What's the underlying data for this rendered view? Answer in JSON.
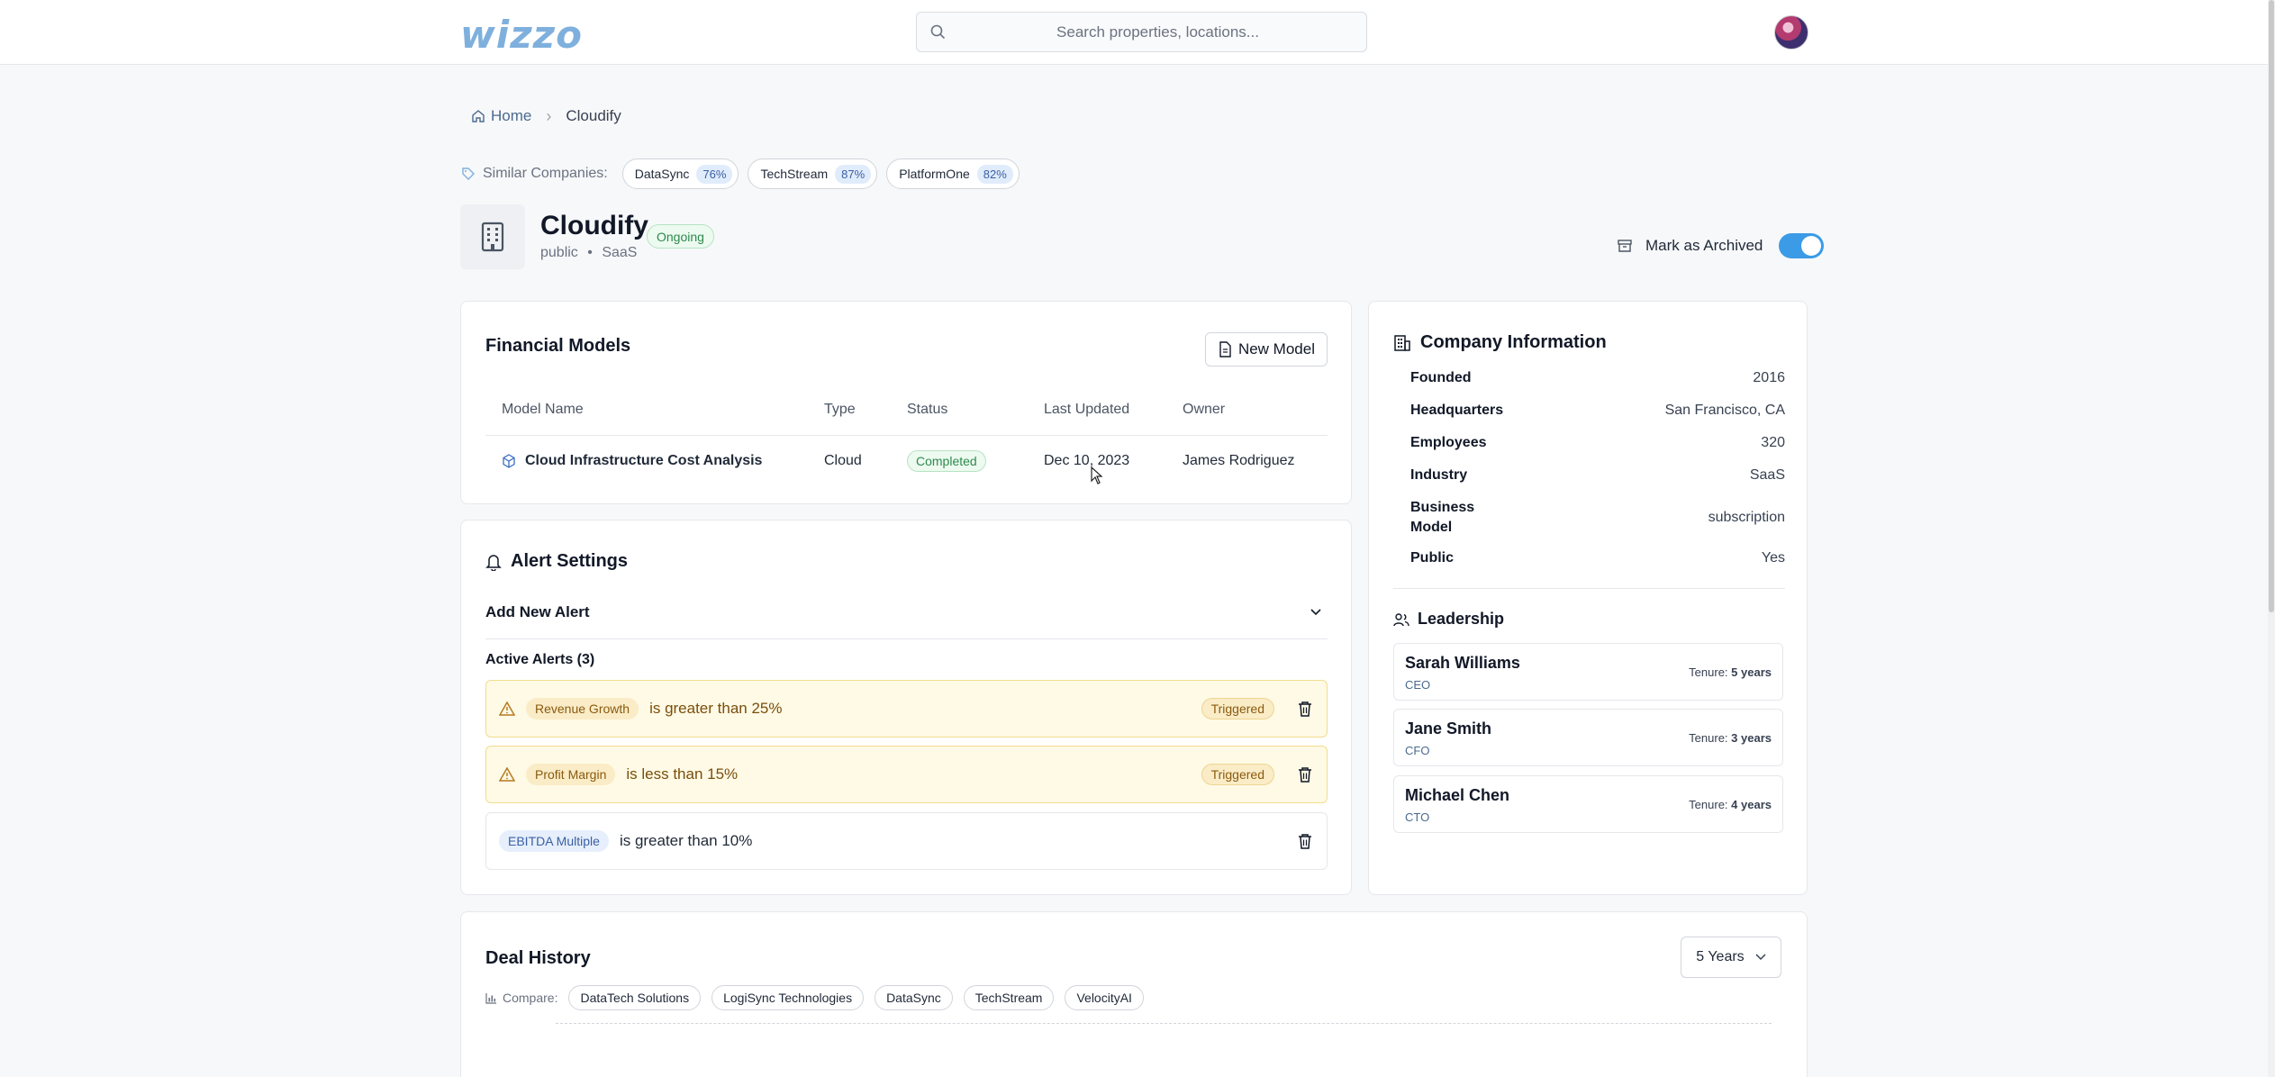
{
  "app": {
    "logo": "wizzo"
  },
  "search": {
    "placeholder": "Search properties, locations..."
  },
  "breadcrumb": {
    "home": "Home",
    "current": "Cloudify"
  },
  "similar": {
    "label": "Similar Companies:",
    "items": [
      {
        "name": "DataSync",
        "pct": "76%"
      },
      {
        "name": "TechStream",
        "pct": "87%"
      },
      {
        "name": "PlatformOne",
        "pct": "82%"
      }
    ]
  },
  "company": {
    "name": "Cloudify",
    "status": "Ongoing",
    "type": "public",
    "sector": "SaaS",
    "separator": "•"
  },
  "archive": {
    "label": "Mark as Archived",
    "enabled": true
  },
  "financial_models": {
    "title": "Financial Models",
    "new_button": "New Model",
    "columns": [
      "Model Name",
      "Type",
      "Status",
      "Last Updated",
      "Owner"
    ],
    "rows": [
      {
        "name": "Cloud Infrastructure Cost Analysis",
        "type": "Cloud",
        "status": "Completed",
        "updated": "Dec 10, 2023",
        "owner": "James Rodriguez"
      }
    ]
  },
  "alerts": {
    "title": "Alert Settings",
    "add_label": "Add New Alert",
    "active_label": "Active Alerts (3)",
    "items": [
      {
        "metric": "Revenue Growth",
        "condition": "is greater than 25%",
        "badge": "Triggered"
      },
      {
        "metric": "Profit Margin",
        "condition": "is less than 15%",
        "badge": "Triggered"
      },
      {
        "metric": "EBITDA Multiple",
        "condition": "is greater than 10%"
      }
    ]
  },
  "company_info": {
    "title": "Company Information",
    "rows": [
      {
        "key": "Founded",
        "value": "2016"
      },
      {
        "key": "Headquarters",
        "value": "San Francisco, CA"
      },
      {
        "key": "Employees",
        "value": "320"
      },
      {
        "key": "Industry",
        "value": "SaaS"
      },
      {
        "key": "Business Model",
        "value": "subscription"
      },
      {
        "key": "Public",
        "value": "Yes"
      }
    ]
  },
  "leadership": {
    "title": "Leadership",
    "tenure_label": "Tenure:",
    "people": [
      {
        "name": "Sarah Williams",
        "role": "CEO",
        "tenure": "5 years"
      },
      {
        "name": "Jane Smith",
        "role": "CFO",
        "tenure": "3 years"
      },
      {
        "name": "Michael Chen",
        "role": "CTO",
        "tenure": "4 years"
      }
    ]
  },
  "deal_history": {
    "title": "Deal History",
    "range": "5 Years",
    "compare_label": "Compare:",
    "compare_items": [
      "DataTech Solutions",
      "LogiSync Technologies",
      "DataSync",
      "TechStream",
      "VelocityAI"
    ]
  }
}
